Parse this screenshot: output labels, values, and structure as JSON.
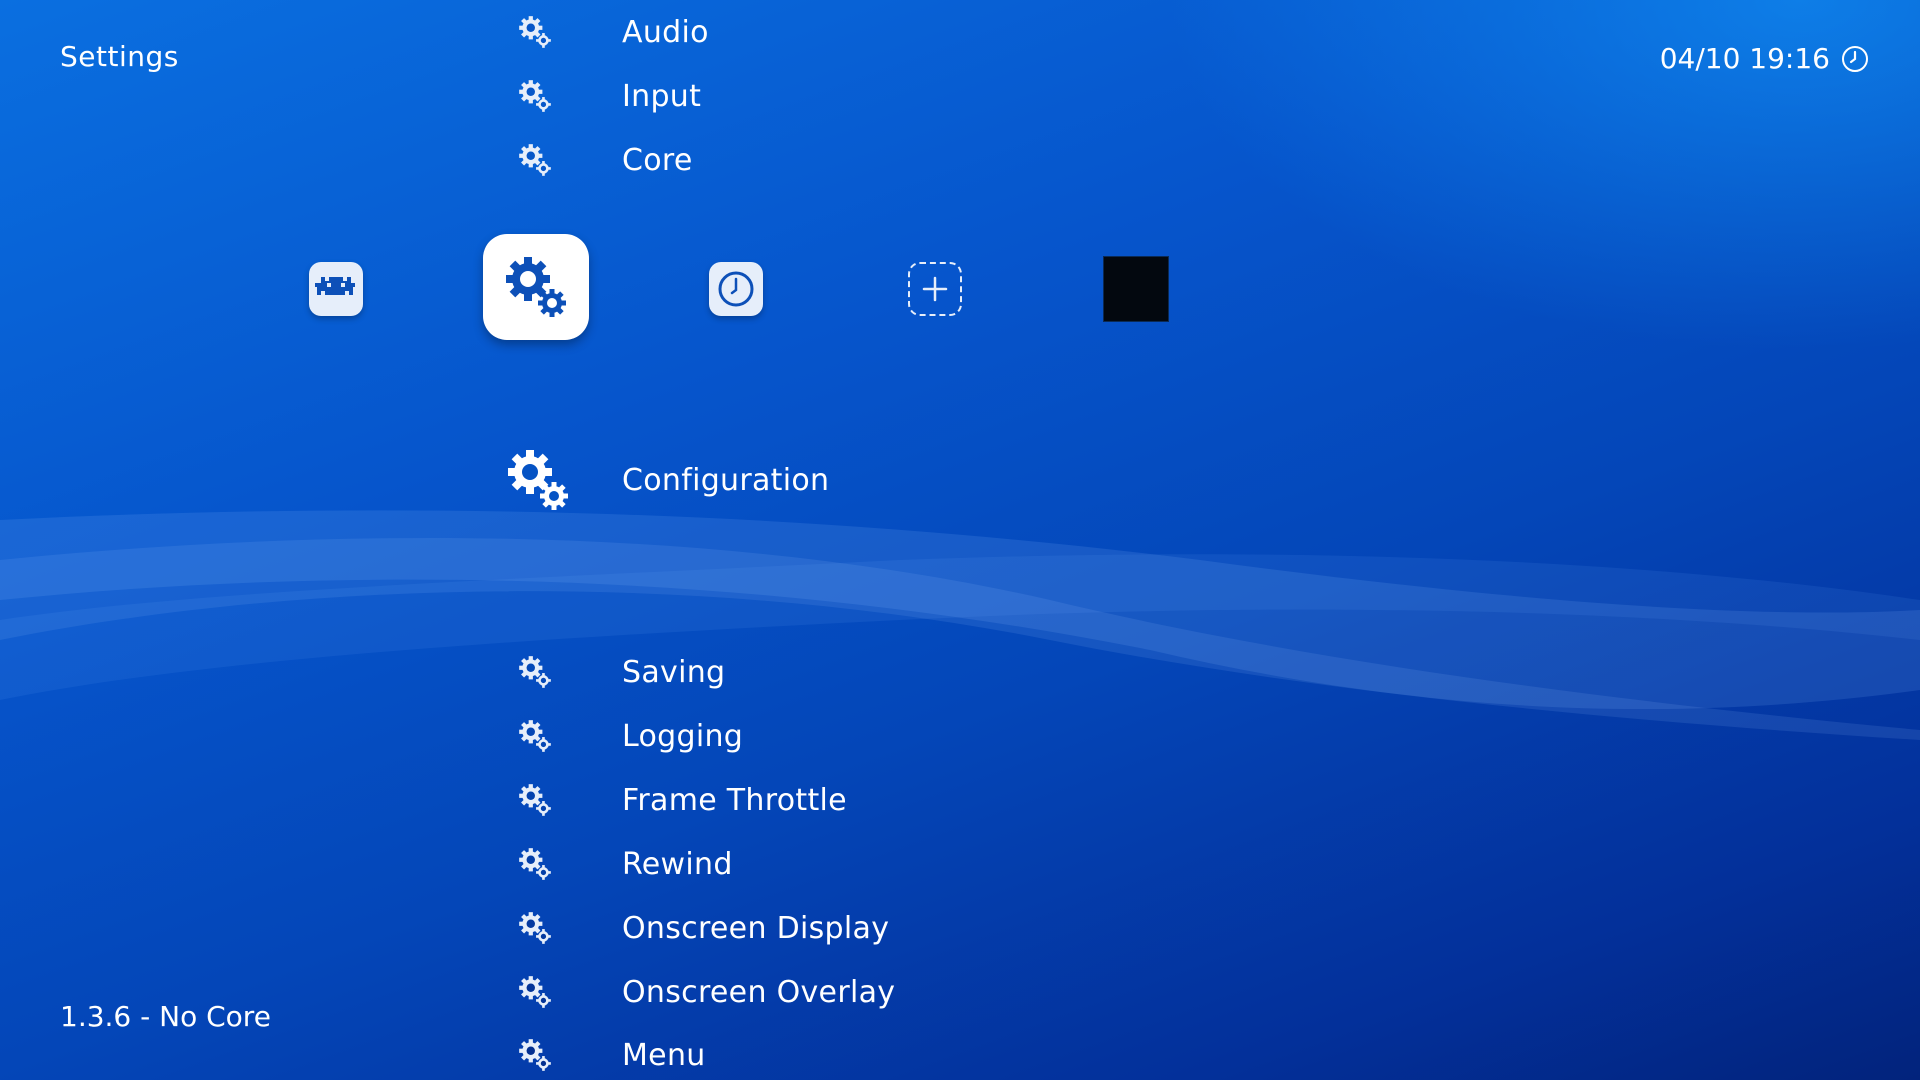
{
  "header": {
    "title": "Settings"
  },
  "clock": {
    "datetime": "04/10 19:16",
    "icon": "clock-icon"
  },
  "footer": {
    "version": "1.3.6 - No Core"
  },
  "tabs": [
    {
      "name": "main-menu",
      "icon": "retroarch-invader-icon"
    },
    {
      "name": "settings",
      "icon": "gears-icon",
      "selected": true
    },
    {
      "name": "history",
      "icon": "history-clock-icon"
    },
    {
      "name": "add",
      "icon": "plus-icon"
    },
    {
      "name": "playlist",
      "icon": "black-square-thumbnail"
    }
  ],
  "menu": {
    "items_above": [
      {
        "label": "Audio"
      },
      {
        "label": "Input"
      },
      {
        "label": "Core"
      }
    ],
    "selected": {
      "label": "Configuration"
    },
    "items_below": [
      {
        "label": "Saving"
      },
      {
        "label": "Logging"
      },
      {
        "label": "Frame Throttle"
      },
      {
        "label": "Rewind"
      },
      {
        "label": "Onscreen Display"
      },
      {
        "label": "Onscreen Overlay"
      },
      {
        "label": "Menu"
      }
    ]
  },
  "colors": {
    "background_top": "#0a6fe0",
    "background_bottom": "#02237c",
    "icon_fill": "#e6eefa",
    "accent_blue": "#0d50b8"
  }
}
